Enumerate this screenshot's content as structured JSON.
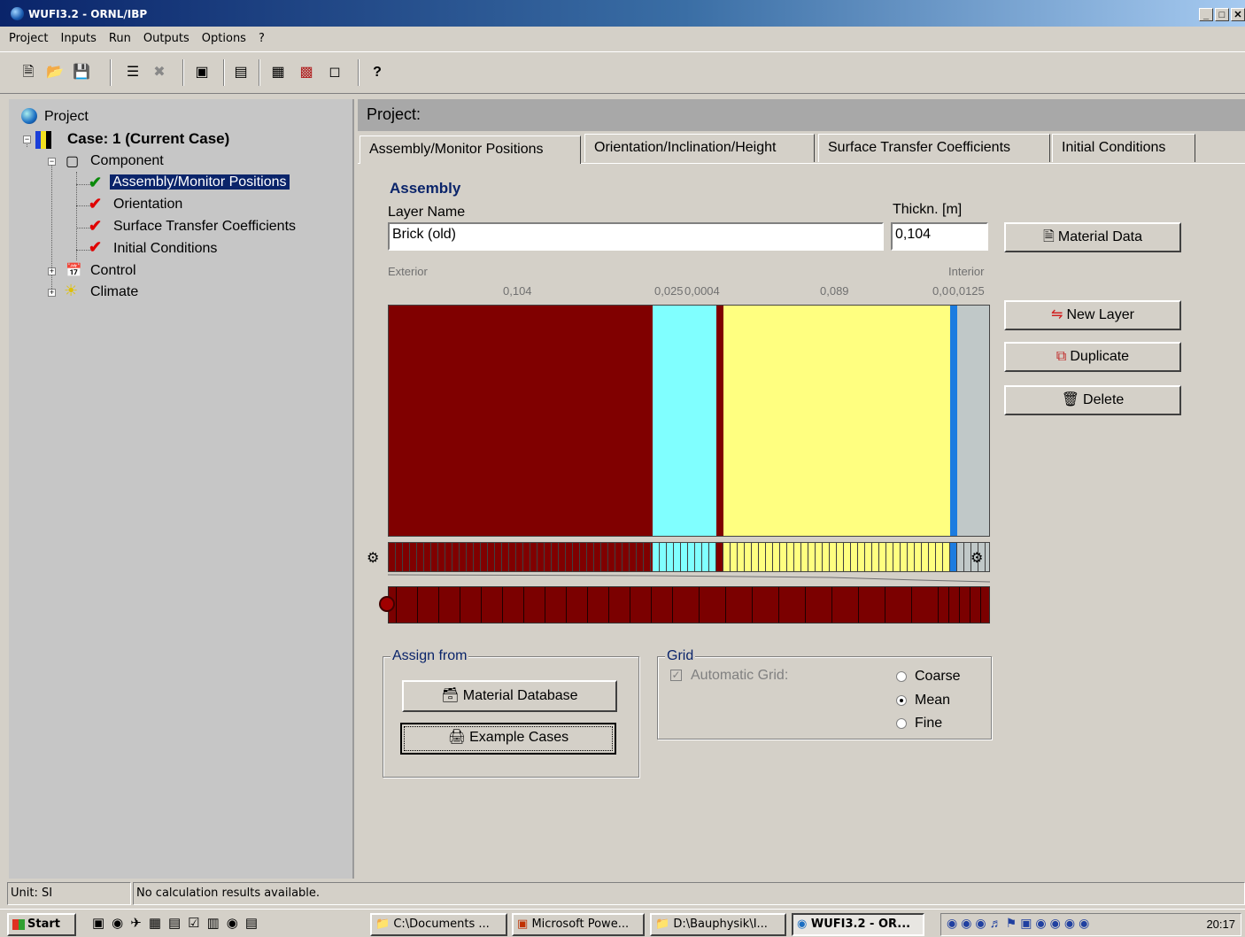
{
  "window": {
    "title": "WUFI3.2 - ORNL/IBP",
    "buttons": [
      "_",
      "□",
      "✕"
    ]
  },
  "menu": [
    "Project",
    "Inputs",
    "Run",
    "Outputs",
    "Options",
    "?"
  ],
  "toolbar": {
    "help": "?"
  },
  "tree": {
    "root": "Project",
    "case": "Case: 1   (Current Case)",
    "component": "Component",
    "items": [
      "Assembly/Monitor Positions",
      "Orientation",
      "Surface Transfer Coefficients",
      "Initial Conditions"
    ],
    "control": "Control",
    "climate": "Climate"
  },
  "header": {
    "title": "Project:"
  },
  "tabs": [
    "Assembly/Monitor Positions",
    "Orientation/Inclination/Height",
    "Surface Transfer Coefficients",
    "Initial Conditions"
  ],
  "assembly": {
    "heading": "Assembly",
    "layer_name_label": "Layer Name",
    "thickness_label": "Thickn. [m]",
    "layer_name_value": "Brick (old)",
    "thickness_value": "0,104",
    "exterior_label": "Exterior",
    "interior_label": "Interior",
    "thickness_labels": [
      "0,104",
      "0,025",
      "0,0004",
      "0,089",
      "0,0",
      "0,0125"
    ]
  },
  "layers": [
    {
      "thickness": 0.104,
      "color": "#800000"
    },
    {
      "thickness": 0.025,
      "color": "#80ffff"
    },
    {
      "thickness": 0.003,
      "color": "#800000"
    },
    {
      "thickness": 0.089,
      "color": "#ffff80"
    },
    {
      "thickness": 0.003,
      "color": "#1c7ce0"
    },
    {
      "thickness": 0.0125,
      "color": "#c0c8c8"
    }
  ],
  "buttons": {
    "material_data": "Material Data",
    "new_layer": "New Layer",
    "duplicate": "Duplicate",
    "delete": "Delete",
    "material_database": "Material Database",
    "example_cases": "Example Cases"
  },
  "assign_from": {
    "legend": "Assign from"
  },
  "grid": {
    "legend": "Grid",
    "automatic_label": "Automatic Grid:",
    "options": [
      "Coarse",
      "Mean",
      "Fine"
    ],
    "selected": "Mean"
  },
  "status": {
    "unit": "Unit: SI",
    "message": "No calculation results available."
  },
  "taskbar": {
    "start": "Start",
    "tasks": [
      "C:\\Documents ...",
      "Microsoft Powe...",
      "D:\\Bauphysik\\I...",
      "WUFI3.2 - OR..."
    ],
    "clock": "20:17"
  }
}
